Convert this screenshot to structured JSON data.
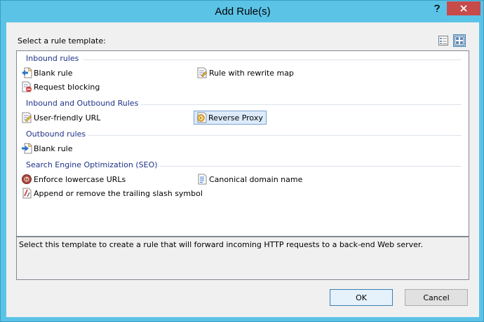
{
  "window": {
    "title": "Add Rule(s)",
    "help_icon": "question-icon",
    "close_icon": "close-icon"
  },
  "prompt": "Select a rule template:",
  "view": {
    "list_icon": "details-view-icon",
    "tile_icon": "tiles-view-icon"
  },
  "groups": [
    {
      "title": "Inbound rules",
      "items": [
        {
          "label": "Blank rule",
          "icon": "blank-inbound-rule-icon"
        },
        {
          "label": "Rule with rewrite map",
          "icon": "rewrite-map-icon"
        },
        {
          "label": "Request blocking",
          "icon": "request-blocking-icon"
        }
      ]
    },
    {
      "title": "Inbound and Outbound Rules",
      "items": [
        {
          "label": "User-friendly URL",
          "icon": "user-friendly-url-icon"
        },
        {
          "label": "Reverse Proxy",
          "icon": "reverse-proxy-icon",
          "selected": true
        }
      ]
    },
    {
      "title": "Outbound rules",
      "items": [
        {
          "label": "Blank rule",
          "icon": "blank-outbound-rule-icon"
        }
      ]
    },
    {
      "title": "Search Engine Optimization (SEO)",
      "items": [
        {
          "label": "Enforce lowercase URLs",
          "icon": "lowercase-url-icon"
        },
        {
          "label": "Canonical domain name",
          "icon": "canonical-domain-icon"
        },
        {
          "label": "Append or remove the trailing slash symbol",
          "icon": "trailing-slash-icon"
        }
      ]
    }
  ],
  "description": "Select this template to create a rule that will forward incoming HTTP requests to a back-end Web server.",
  "buttons": {
    "ok": "OK",
    "cancel": "Cancel"
  }
}
